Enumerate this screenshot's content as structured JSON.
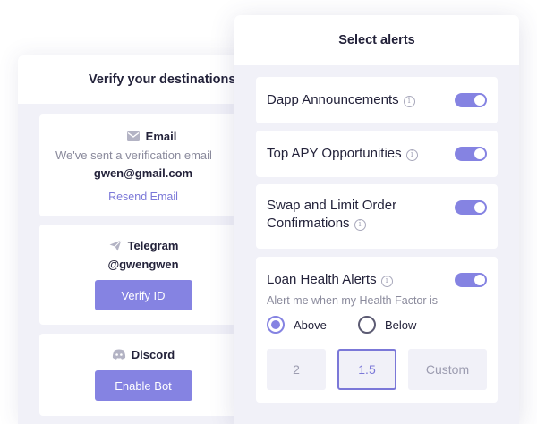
{
  "verify": {
    "title": "Verify your destinations",
    "email": {
      "title": "Email",
      "icon": "envelope-icon",
      "description": "We've sent a verification email",
      "value": "gwen@gmail.com",
      "action": "Resend Email"
    },
    "telegram": {
      "title": "Telegram",
      "icon": "paper-plane-icon",
      "value": "@gwengwen",
      "action": "Verify ID"
    },
    "discord": {
      "title": "Discord",
      "icon": "discord-icon",
      "action": "Enable Bot"
    }
  },
  "alerts": {
    "title": "Select alerts",
    "items": [
      {
        "label": "Dapp Announcements",
        "enabled": true
      },
      {
        "label": "Top APY Opportunities",
        "enabled": true
      },
      {
        "label": "Swap and Limit Order Confirmations",
        "enabled": true
      },
      {
        "label": "Loan Health Alerts",
        "enabled": true
      }
    ],
    "loan": {
      "subtext": "Alert me when my Health Factor is",
      "radio_above": "Above",
      "radio_below": "Below",
      "selected": "Above",
      "options": [
        "2",
        "1.5",
        "Custom"
      ],
      "selected_option": "1.5"
    }
  },
  "colors": {
    "accent": "#8583e2",
    "panel_bg": "#f1f1f8",
    "text": "#23223a",
    "muted": "#8a8a9c"
  }
}
